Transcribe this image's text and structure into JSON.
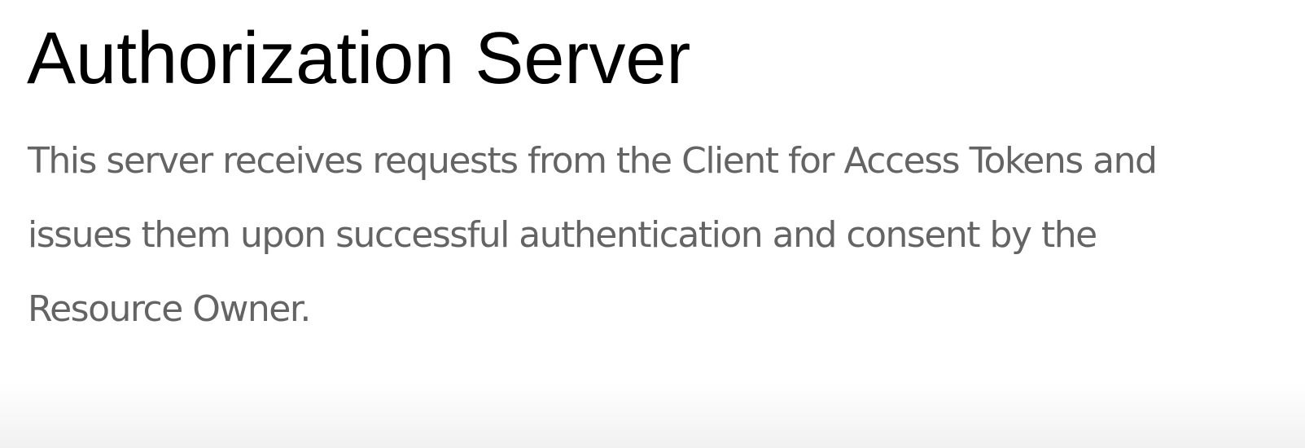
{
  "slide": {
    "title": "Authorization Server",
    "body_lines": [
      "This server receives requests from the Client for Access Tokens and",
      "issues them upon successful authentication and consent by the",
      "Resource Owner."
    ],
    "colors": {
      "title": "#000000",
      "body": "#646464",
      "background": "#ffffff"
    }
  }
}
